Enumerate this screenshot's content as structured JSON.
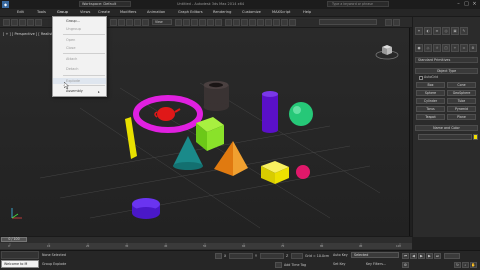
{
  "titlebar": {
    "workspace_label": "Workspace: Default",
    "title": "Untitled - Autodesk 3ds Max 2014 x64",
    "search_placeholder": "Type a keyword or phrase"
  },
  "menubar": {
    "items": [
      "Edit",
      "Tools",
      "Group",
      "Views",
      "Create",
      "Modifiers",
      "Animation",
      "Graph Editors",
      "Rendering",
      "Customize",
      "MAXScript",
      "Help"
    ]
  },
  "toolbar": {
    "view_select": "View"
  },
  "viewport": {
    "label": "[ + ] [ Perspective ] [ Realistic ]"
  },
  "group_menu": {
    "items": [
      "Group...",
      "Ungroup",
      "Open",
      "Close",
      "Attach",
      "Detach",
      "Explode",
      "Assembly"
    ],
    "disabled": [
      "Ungroup",
      "Open",
      "Close",
      "Attach",
      "Detach",
      "Explode"
    ]
  },
  "command_panel": {
    "dropdown": "Standard Primitives",
    "object_type_header": "Object Type",
    "autogrid_label": "AutoGrid",
    "object_buttons": [
      "Box",
      "Cone",
      "Sphere",
      "GeoSphere",
      "Cylinder",
      "Tube",
      "Torus",
      "Pyramid",
      "Teapot",
      "Plane"
    ],
    "name_color_header": "Name and Color",
    "swatch_color": "#f2e000"
  },
  "timeline": {
    "frame": "0 / 100",
    "ticks": [
      "0",
      "10",
      "20",
      "30",
      "40",
      "50",
      "60",
      "70",
      "80",
      "90",
      "100"
    ]
  },
  "statusbar": {
    "listener": "Welcome to M",
    "selection": "None Selected",
    "prompt": "Group Explode",
    "x_label": "X",
    "y_label": "Y",
    "z_label": "Z",
    "grid": "Grid = 10.0cm",
    "autokey": "Auto Key",
    "selected": "Selected",
    "setkey": "Set Key",
    "keyfilters": "Key Filters...",
    "addtimetag": "Add Time Tag"
  },
  "colors": {
    "torus": "#e020e0",
    "teapot": "#e01818",
    "box_green": "#7ee21a",
    "cone": "#1a8a8a",
    "pyramid": "#e88a12",
    "cylinder_blue": "#5a10c8"
  }
}
